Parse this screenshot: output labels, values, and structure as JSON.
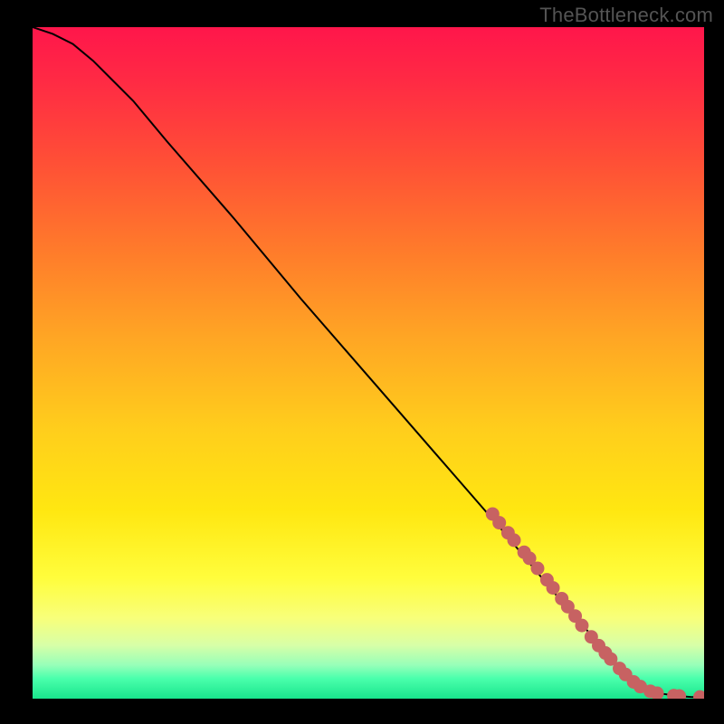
{
  "watermark": "TheBottleneck.com",
  "chart_data": {
    "type": "line",
    "title": "",
    "xlabel": "",
    "ylabel": "",
    "xlim": [
      0,
      100
    ],
    "ylim": [
      0,
      100
    ],
    "curve": {
      "name": "bottleneck-curve",
      "x": [
        0,
        3,
        6,
        9,
        12,
        15,
        20,
        30,
        40,
        50,
        60,
        70,
        80,
        85,
        88,
        90,
        92,
        94,
        96,
        98,
        100
      ],
      "y": [
        100,
        99,
        97.5,
        95,
        92,
        89,
        83,
        71.5,
        59.5,
        48,
        36.5,
        25,
        13,
        7.5,
        4,
        2.2,
        1.2,
        0.7,
        0.4,
        0.25,
        0.2
      ]
    },
    "markers": {
      "name": "highlighted-segment",
      "points": [
        {
          "x": 68.5,
          "y": 27.5
        },
        {
          "x": 69.5,
          "y": 26.2
        },
        {
          "x": 70.8,
          "y": 24.7
        },
        {
          "x": 71.7,
          "y": 23.6
        },
        {
          "x": 73.2,
          "y": 21.8
        },
        {
          "x": 74.0,
          "y": 20.9
        },
        {
          "x": 75.2,
          "y": 19.4
        },
        {
          "x": 76.6,
          "y": 17.7
        },
        {
          "x": 77.5,
          "y": 16.5
        },
        {
          "x": 78.8,
          "y": 14.9
        },
        {
          "x": 79.7,
          "y": 13.7
        },
        {
          "x": 80.8,
          "y": 12.3
        },
        {
          "x": 81.8,
          "y": 10.9
        },
        {
          "x": 83.2,
          "y": 9.2
        },
        {
          "x": 84.3,
          "y": 7.9
        },
        {
          "x": 85.3,
          "y": 6.8
        },
        {
          "x": 86.1,
          "y": 5.9
        },
        {
          "x": 87.4,
          "y": 4.5
        },
        {
          "x": 88.3,
          "y": 3.6
        },
        {
          "x": 89.5,
          "y": 2.5
        },
        {
          "x": 90.5,
          "y": 1.8
        },
        {
          "x": 92.0,
          "y": 1.1
        },
        {
          "x": 93.0,
          "y": 0.8
        },
        {
          "x": 95.5,
          "y": 0.45
        },
        {
          "x": 96.3,
          "y": 0.4
        },
        {
          "x": 99.4,
          "y": 0.25
        }
      ]
    },
    "gradient_stops": [
      {
        "pos": 0.0,
        "color": "#ff164b"
      },
      {
        "pos": 0.08,
        "color": "#ff2a44"
      },
      {
        "pos": 0.2,
        "color": "#ff4f36"
      },
      {
        "pos": 0.33,
        "color": "#ff7a2b"
      },
      {
        "pos": 0.46,
        "color": "#ffa524"
      },
      {
        "pos": 0.6,
        "color": "#ffce1c"
      },
      {
        "pos": 0.72,
        "color": "#ffe711"
      },
      {
        "pos": 0.82,
        "color": "#fffd3c"
      },
      {
        "pos": 0.88,
        "color": "#f8ff7a"
      },
      {
        "pos": 0.92,
        "color": "#d8ffa7"
      },
      {
        "pos": 0.95,
        "color": "#97ffb9"
      },
      {
        "pos": 0.97,
        "color": "#4affac"
      },
      {
        "pos": 1.0,
        "color": "#19e58c"
      }
    ],
    "marker_color": "#C76262",
    "marker_radius_px": 7
  }
}
